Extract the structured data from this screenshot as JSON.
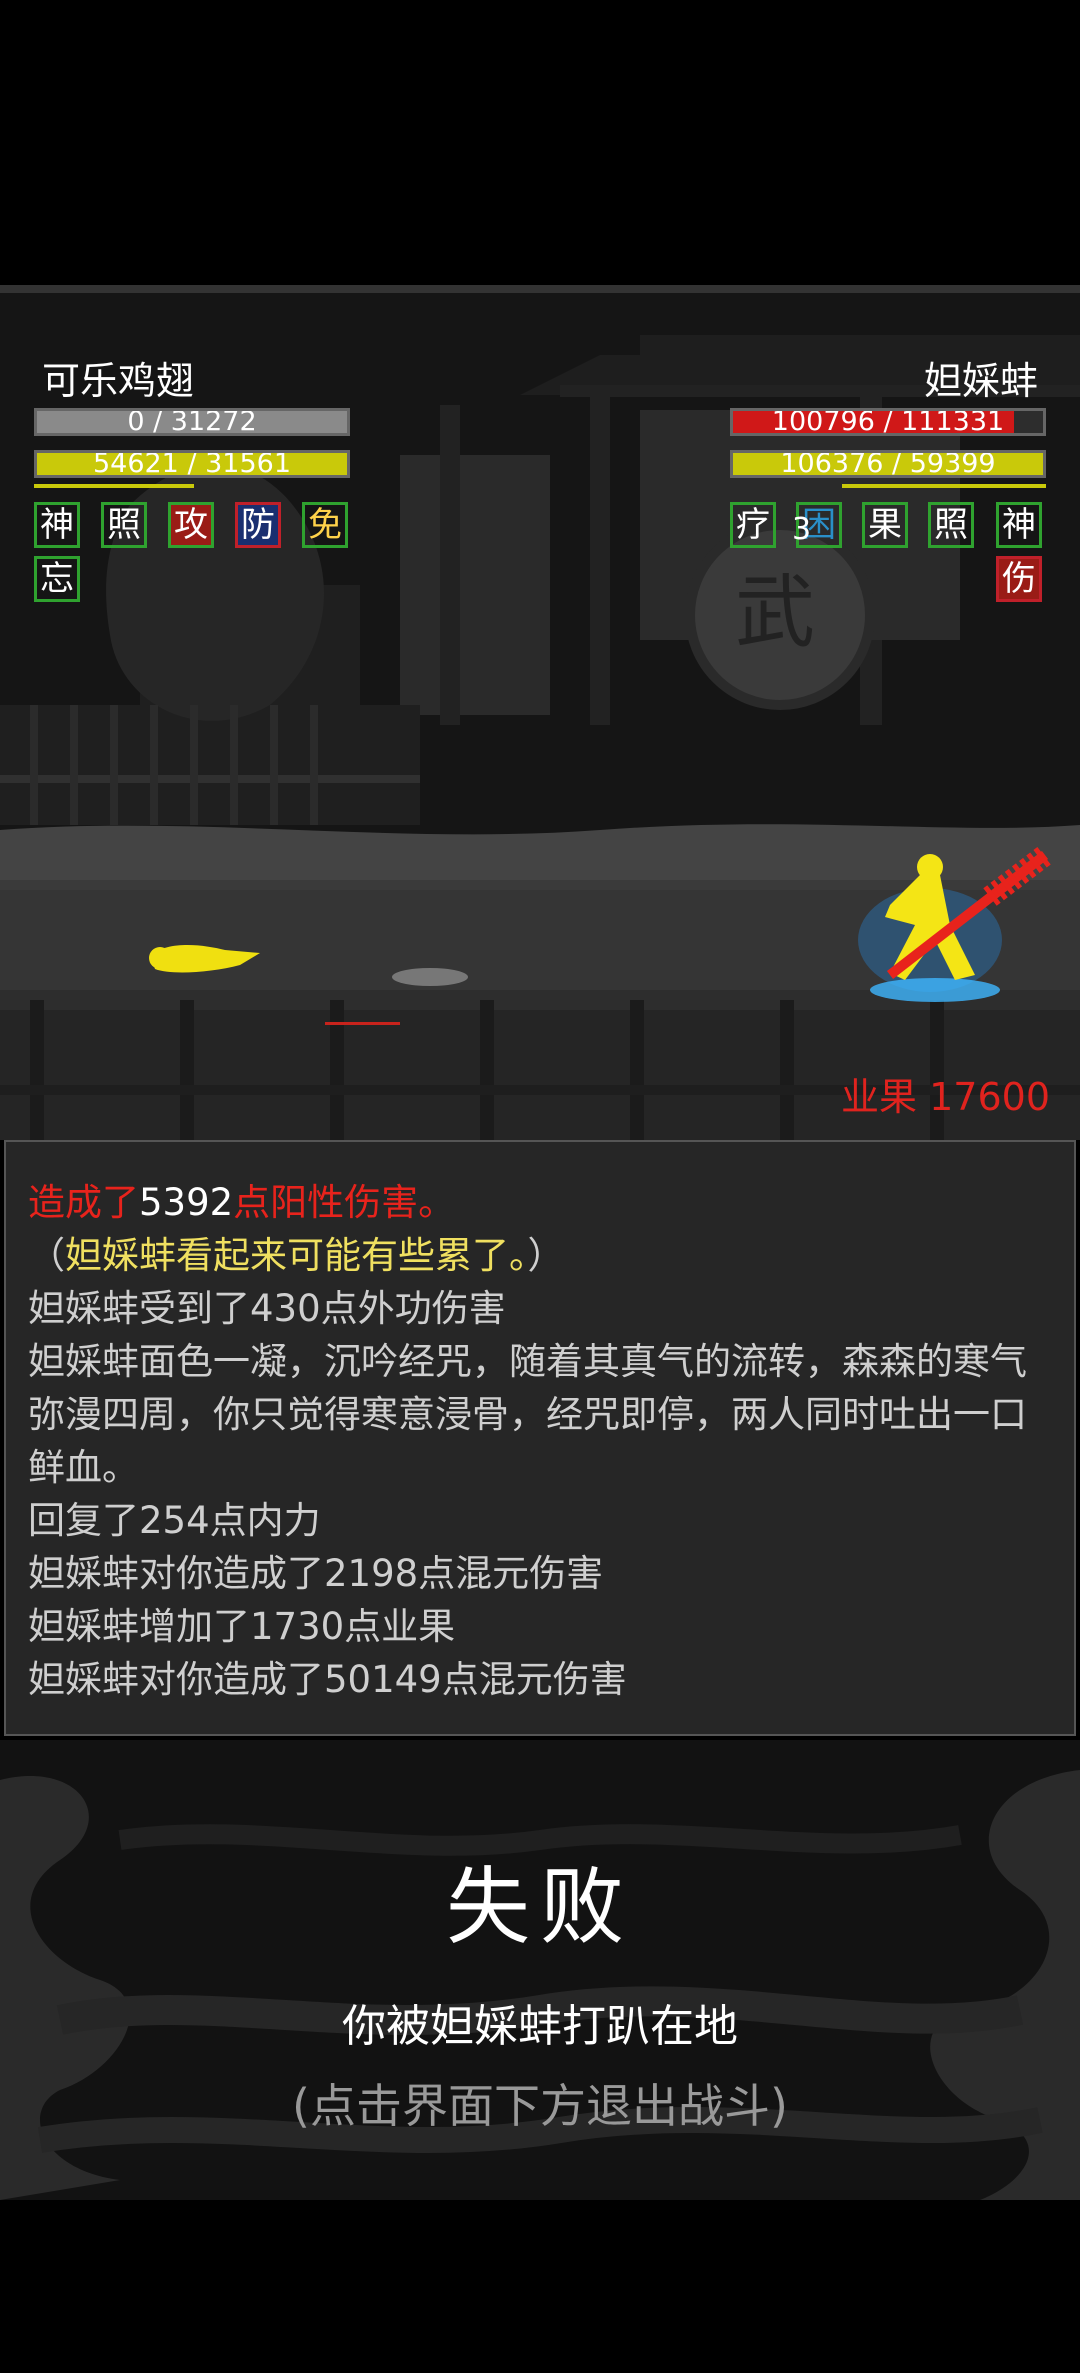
{
  "player": {
    "name": "可乐鸡翅",
    "hp_text": "0 / 31272",
    "mp_text": "54621 / 31561",
    "statuses": [
      "神",
      "照",
      "攻",
      "防",
      "免",
      "忘"
    ]
  },
  "enemy": {
    "name": "妲婇蚌",
    "hp_text": "100796 / 111331",
    "mp_text": "106376 / 59399",
    "statuses": [
      "疗",
      "困",
      "果",
      "照",
      "神",
      "伤"
    ],
    "stack_count": "3"
  },
  "karma": {
    "label": "业果",
    "value": "17600"
  },
  "log": {
    "line1_prefix": "造成了",
    "line1_value": "5392",
    "line1_suffix": "点阳性伤害。",
    "line2_open": "（",
    "line2_text": "妲婇蚌看起来可能有些累了。",
    "line2_close": "）",
    "lines": [
      "妲婇蚌受到了430点外功伤害",
      "妲婇蚌面色一凝，沉吟经咒，随着其真气的流转，森森的寒气弥漫四周，你只觉得寒意浸骨，经咒即停，两人同时吐出一口鲜血。",
      "回复了254点内力",
      "妲婇蚌对你造成了2198点混元伤害",
      "妲婇蚌增加了1730点业果",
      "妲婇蚌对你造成了50149点混元伤害"
    ]
  },
  "result": {
    "title": "失败",
    "message": "你被妲婇蚌打趴在地",
    "hint": "(点击界面下方退出战斗)"
  },
  "colors": {
    "hp_fill": "#8a8a8a",
    "mp_fill": "#c9c90a",
    "enemy_hp_fill": "#d01818",
    "status_border_green": "#2fa22f",
    "status_border_red": "#c0202a",
    "status_bg_red": "#9a1c16",
    "karma": "#e0231e",
    "highlight_red": "#e8231c",
    "highlight_yellow": "#f0e060"
  }
}
